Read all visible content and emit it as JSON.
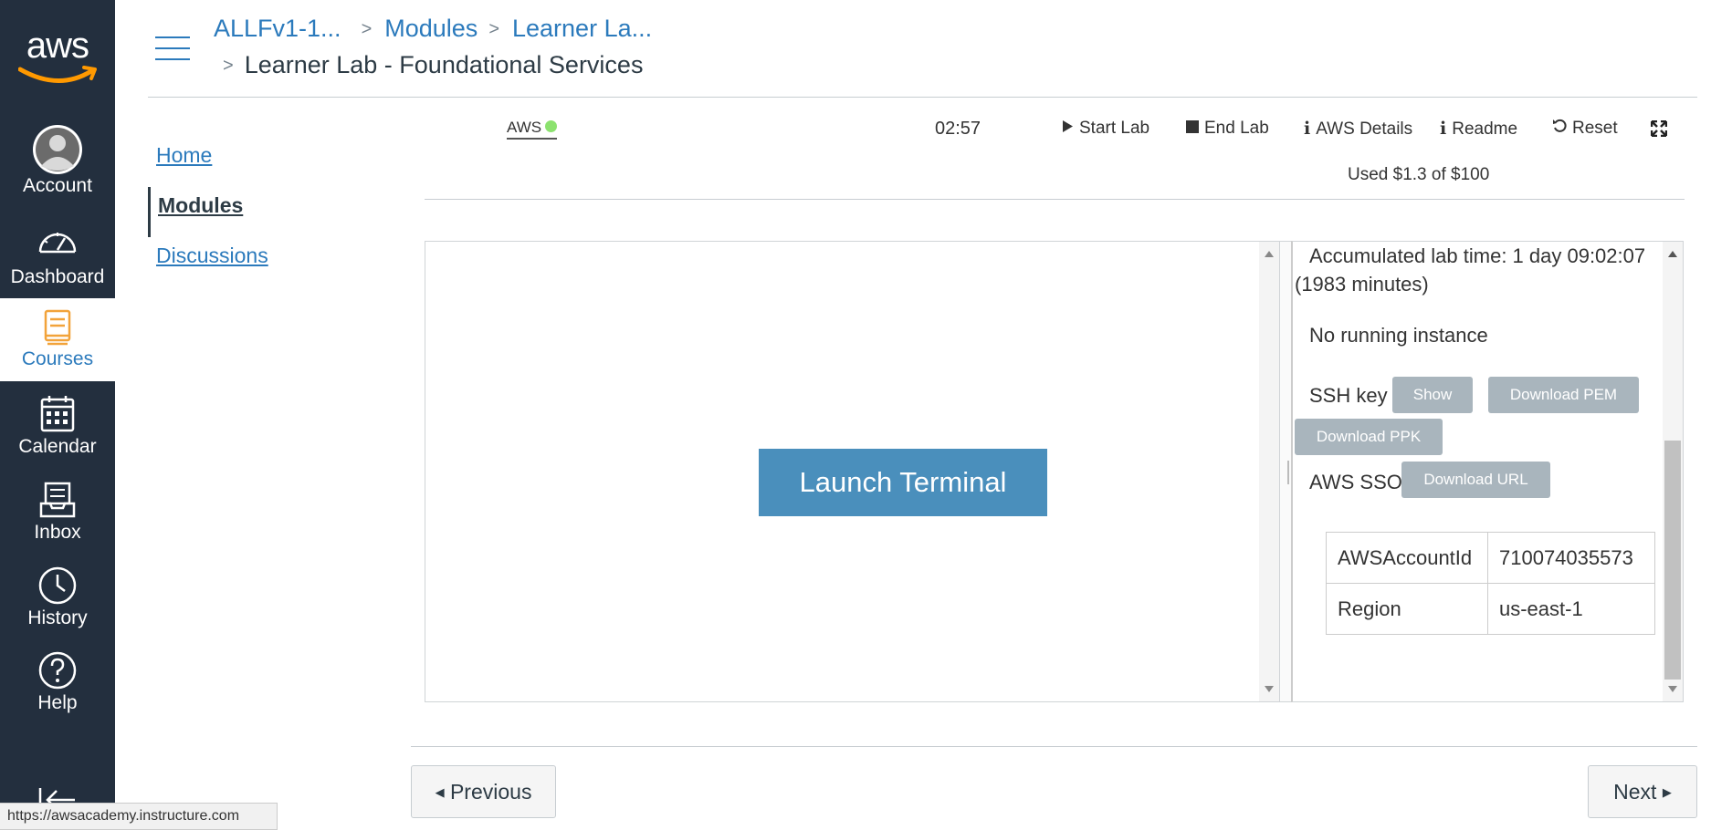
{
  "global_nav": {
    "logo_text": "aws",
    "items": [
      {
        "label": "Account"
      },
      {
        "label": "Dashboard"
      },
      {
        "label": "Courses"
      },
      {
        "label": "Calendar"
      },
      {
        "label": "Inbox"
      },
      {
        "label": "History"
      },
      {
        "label": "Help"
      }
    ]
  },
  "breadcrumb": {
    "items": [
      "ALLFv1-1...",
      "Modules",
      "Learner La..."
    ],
    "current": "Learner Lab - Foundational Services"
  },
  "course_nav": {
    "items": [
      {
        "label": "Home"
      },
      {
        "label": "Modules"
      },
      {
        "label": "Discussions"
      }
    ]
  },
  "lab_toolbar": {
    "status_label": "AWS",
    "status_color": "#8ce26f",
    "timer": "02:57",
    "start_lab": "Start Lab",
    "end_lab": "End Lab",
    "aws_details": "AWS Details",
    "readme": "Readme",
    "reset": "Reset",
    "budget": "Used $1.3 of $100"
  },
  "terminal": {
    "launch_label": "Launch Terminal"
  },
  "details": {
    "accumulated_line1": "Accumulated lab time: 1 day 09:02:07",
    "accumulated_line2": "(1983 minutes)",
    "instance_status": "No running instance",
    "ssh_key_label": "SSH key",
    "show_label": "Show",
    "download_pem_label": "Download PEM",
    "download_ppk_label": "Download PPK",
    "aws_sso_label": "AWS SSO",
    "download_url_label": "Download URL",
    "table": [
      {
        "key": "AWSAccountId",
        "value": "710074035573"
      },
      {
        "key": "Region",
        "value": "us-east-1"
      }
    ]
  },
  "pagination": {
    "previous": "Previous",
    "next": "Next"
  },
  "status_bar": {
    "url": "https://awsacademy.instructure.com"
  },
  "colors": {
    "nav_bg": "#232f3e",
    "link": "#2b7abc",
    "launch_button": "#4a8fbc",
    "gray_button": "#a9b5bd"
  }
}
